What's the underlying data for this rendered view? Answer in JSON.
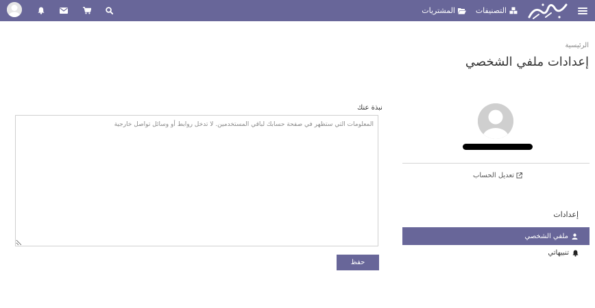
{
  "nav": {
    "categories_label": "التصنيفات",
    "purchases_label": "المشتريات",
    "icons": [
      "menu-icon",
      "logo",
      "search-icon",
      "cart-icon",
      "mail-icon",
      "bell-icon",
      "user-avatar"
    ]
  },
  "page": {
    "breadcrumb": "الرئيسية",
    "title": "إعدادات ملفي الشخصي"
  },
  "profile": {
    "edit_account_label": "تعديل الحساب"
  },
  "sidebar": {
    "heading": "إعدادات",
    "items": [
      {
        "label": "ملفي الشخصي",
        "icon": "user-icon",
        "active": true
      },
      {
        "label": "تنبيهاتي",
        "icon": "bell-icon",
        "active": false
      }
    ]
  },
  "bio": {
    "label": "نبذة عنك",
    "placeholder": "المعلومات التي ستظهر في صفحة حسابك لباقي المستخدمين. لا تدخل روابط أو وسائل تواصل خارجية",
    "value": ""
  },
  "form": {
    "save_label": "حفظ"
  },
  "colors": {
    "brand": "#686699"
  }
}
